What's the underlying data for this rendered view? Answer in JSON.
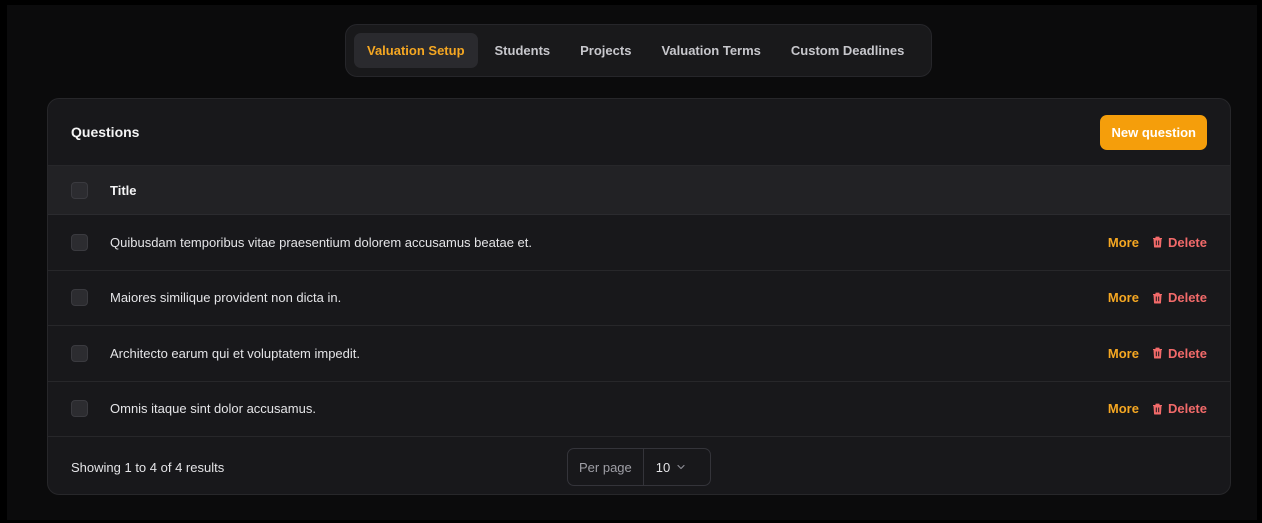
{
  "tabs": [
    {
      "label": "Valuation Setup",
      "active": true
    },
    {
      "label": "Students",
      "active": false
    },
    {
      "label": "Projects",
      "active": false
    },
    {
      "label": "Valuation Terms",
      "active": false
    },
    {
      "label": "Custom Deadlines",
      "active": false
    }
  ],
  "card": {
    "title": "Questions",
    "new_button_label": "New question"
  },
  "table": {
    "column_title": "Title",
    "rows": [
      {
        "title": "Quibusdam temporibus vitae praesentium dolorem accusamus beatae et.",
        "more": "More",
        "delete": "Delete"
      },
      {
        "title": "Maiores similique provident non dicta in.",
        "more": "More",
        "delete": "Delete"
      },
      {
        "title": "Architecto earum qui et voluptatem impedit.",
        "more": "More",
        "delete": "Delete"
      },
      {
        "title": "Omnis itaque sint dolor accusamus.",
        "more": "More",
        "delete": "Delete"
      }
    ]
  },
  "footer": {
    "results_text": "Showing 1 to 4 of 4 results",
    "per_page_label": "Per page",
    "per_page_value": "10"
  },
  "colors": {
    "accent": "#f59e0b",
    "danger": "#f26a6a",
    "background": "#0b0b0c",
    "card": "#18181b"
  }
}
